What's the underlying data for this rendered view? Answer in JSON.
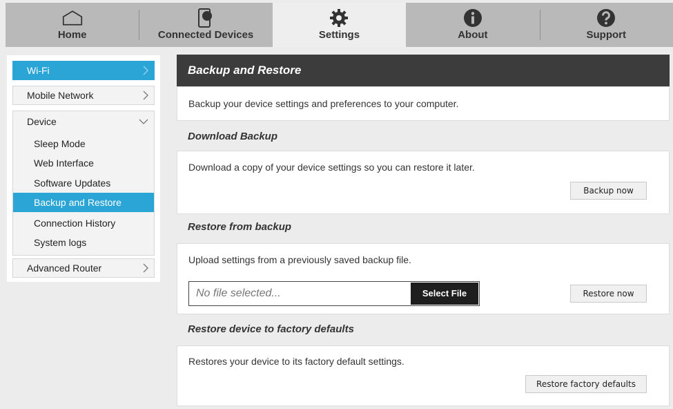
{
  "nav": {
    "tabs": [
      {
        "label": "Home",
        "icon": "home-icon"
      },
      {
        "label": "Connected Devices",
        "icon": "device-icon"
      },
      {
        "label": "Settings",
        "icon": "gear-icon"
      },
      {
        "label": "About",
        "icon": "info-icon"
      },
      {
        "label": "Support",
        "icon": "help-icon"
      }
    ],
    "active": "Settings"
  },
  "sidebar": {
    "wifi": "Wi-Fi",
    "mobile_network": "Mobile Network",
    "device": "Device",
    "device_items": [
      "Sleep Mode",
      "Web Interface",
      "Software Updates",
      "Backup and Restore",
      "Connection History",
      "System logs"
    ],
    "advanced_router": "Advanced Router"
  },
  "main": {
    "title": "Backup and Restore",
    "intro": "Backup your device settings and preferences to your computer.",
    "download": {
      "title": "Download Backup",
      "text": "Download a copy of your device settings so you can restore it later.",
      "button": "Backup now"
    },
    "restore": {
      "title": "Restore from backup",
      "text": "Upload settings from a previously saved backup file.",
      "file_placeholder": "No file selected...",
      "select_button": "Select File",
      "button": "Restore now"
    },
    "factory": {
      "title": "Restore device to factory defaults",
      "text": "Restores your device to its factory default settings.",
      "button": "Restore factory defaults"
    }
  },
  "colors": {
    "accent": "#2aa5d6",
    "header": "#3c3c3c",
    "nav": "#b9b9b9"
  }
}
